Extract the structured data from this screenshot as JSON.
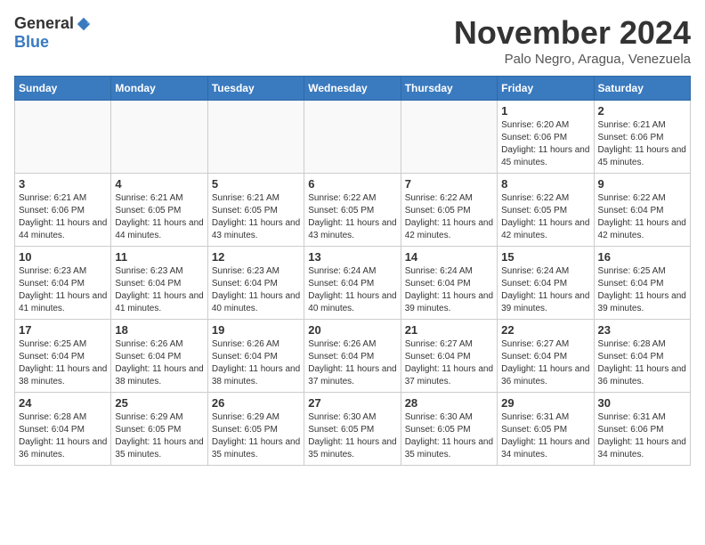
{
  "logo": {
    "general": "General",
    "blue": "Blue"
  },
  "title": "November 2024",
  "location": "Palo Negro, Aragua, Venezuela",
  "weekdays": [
    "Sunday",
    "Monday",
    "Tuesday",
    "Wednesday",
    "Thursday",
    "Friday",
    "Saturday"
  ],
  "weeks": [
    [
      {
        "day": "",
        "info": ""
      },
      {
        "day": "",
        "info": ""
      },
      {
        "day": "",
        "info": ""
      },
      {
        "day": "",
        "info": ""
      },
      {
        "day": "",
        "info": ""
      },
      {
        "day": "1",
        "info": "Sunrise: 6:20 AM\nSunset: 6:06 PM\nDaylight: 11 hours and 45 minutes."
      },
      {
        "day": "2",
        "info": "Sunrise: 6:21 AM\nSunset: 6:06 PM\nDaylight: 11 hours and 45 minutes."
      }
    ],
    [
      {
        "day": "3",
        "info": "Sunrise: 6:21 AM\nSunset: 6:06 PM\nDaylight: 11 hours and 44 minutes."
      },
      {
        "day": "4",
        "info": "Sunrise: 6:21 AM\nSunset: 6:05 PM\nDaylight: 11 hours and 44 minutes."
      },
      {
        "day": "5",
        "info": "Sunrise: 6:21 AM\nSunset: 6:05 PM\nDaylight: 11 hours and 43 minutes."
      },
      {
        "day": "6",
        "info": "Sunrise: 6:22 AM\nSunset: 6:05 PM\nDaylight: 11 hours and 43 minutes."
      },
      {
        "day": "7",
        "info": "Sunrise: 6:22 AM\nSunset: 6:05 PM\nDaylight: 11 hours and 42 minutes."
      },
      {
        "day": "8",
        "info": "Sunrise: 6:22 AM\nSunset: 6:05 PM\nDaylight: 11 hours and 42 minutes."
      },
      {
        "day": "9",
        "info": "Sunrise: 6:22 AM\nSunset: 6:04 PM\nDaylight: 11 hours and 42 minutes."
      }
    ],
    [
      {
        "day": "10",
        "info": "Sunrise: 6:23 AM\nSunset: 6:04 PM\nDaylight: 11 hours and 41 minutes."
      },
      {
        "day": "11",
        "info": "Sunrise: 6:23 AM\nSunset: 6:04 PM\nDaylight: 11 hours and 41 minutes."
      },
      {
        "day": "12",
        "info": "Sunrise: 6:23 AM\nSunset: 6:04 PM\nDaylight: 11 hours and 40 minutes."
      },
      {
        "day": "13",
        "info": "Sunrise: 6:24 AM\nSunset: 6:04 PM\nDaylight: 11 hours and 40 minutes."
      },
      {
        "day": "14",
        "info": "Sunrise: 6:24 AM\nSunset: 6:04 PM\nDaylight: 11 hours and 39 minutes."
      },
      {
        "day": "15",
        "info": "Sunrise: 6:24 AM\nSunset: 6:04 PM\nDaylight: 11 hours and 39 minutes."
      },
      {
        "day": "16",
        "info": "Sunrise: 6:25 AM\nSunset: 6:04 PM\nDaylight: 11 hours and 39 minutes."
      }
    ],
    [
      {
        "day": "17",
        "info": "Sunrise: 6:25 AM\nSunset: 6:04 PM\nDaylight: 11 hours and 38 minutes."
      },
      {
        "day": "18",
        "info": "Sunrise: 6:26 AM\nSunset: 6:04 PM\nDaylight: 11 hours and 38 minutes."
      },
      {
        "day": "19",
        "info": "Sunrise: 6:26 AM\nSunset: 6:04 PM\nDaylight: 11 hours and 38 minutes."
      },
      {
        "day": "20",
        "info": "Sunrise: 6:26 AM\nSunset: 6:04 PM\nDaylight: 11 hours and 37 minutes."
      },
      {
        "day": "21",
        "info": "Sunrise: 6:27 AM\nSunset: 6:04 PM\nDaylight: 11 hours and 37 minutes."
      },
      {
        "day": "22",
        "info": "Sunrise: 6:27 AM\nSunset: 6:04 PM\nDaylight: 11 hours and 36 minutes."
      },
      {
        "day": "23",
        "info": "Sunrise: 6:28 AM\nSunset: 6:04 PM\nDaylight: 11 hours and 36 minutes."
      }
    ],
    [
      {
        "day": "24",
        "info": "Sunrise: 6:28 AM\nSunset: 6:04 PM\nDaylight: 11 hours and 36 minutes."
      },
      {
        "day": "25",
        "info": "Sunrise: 6:29 AM\nSunset: 6:05 PM\nDaylight: 11 hours and 35 minutes."
      },
      {
        "day": "26",
        "info": "Sunrise: 6:29 AM\nSunset: 6:05 PM\nDaylight: 11 hours and 35 minutes."
      },
      {
        "day": "27",
        "info": "Sunrise: 6:30 AM\nSunset: 6:05 PM\nDaylight: 11 hours and 35 minutes."
      },
      {
        "day": "28",
        "info": "Sunrise: 6:30 AM\nSunset: 6:05 PM\nDaylight: 11 hours and 35 minutes."
      },
      {
        "day": "29",
        "info": "Sunrise: 6:31 AM\nSunset: 6:05 PM\nDaylight: 11 hours and 34 minutes."
      },
      {
        "day": "30",
        "info": "Sunrise: 6:31 AM\nSunset: 6:06 PM\nDaylight: 11 hours and 34 minutes."
      }
    ]
  ]
}
